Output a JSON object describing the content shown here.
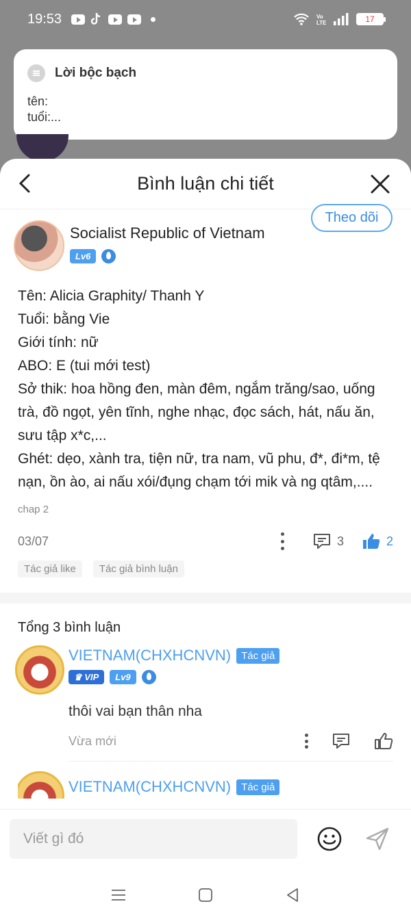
{
  "status_bar": {
    "time": "19:53",
    "battery": "17"
  },
  "notice": {
    "title": "Lời bộc bạch",
    "lines": [
      "tên:",
      "tuổi:..."
    ]
  },
  "sheet": {
    "title": "Bình luận chi tiết"
  },
  "post": {
    "author": "Socialist Republic of Vietnam",
    "level": "Lv6",
    "follow_label": "Theo dõi",
    "body": [
      "Tên: Alicia Graphity/ Thanh Y",
      "Tuổi: bằng Vie",
      "Giới tính: nữ",
      "ABO: E (tui mới test)",
      "Sở thik: hoa hồng đen, màn đêm, ngắm trăng/sao, uống trà, đồ ngọt, yên tĩnh, nghe nhạc, đọc sách, hát, nấu ăn, sưu tập x*c,...",
      "Ghét: dẹo, xành tra, tiện nữ, tra nam, vũ phu, đ*, đi*m, tệ nạn, ồn ào, ai nấu xói/đụng chạm tới mik và ng qtâm,...."
    ],
    "chapter": "chap 2",
    "date": "03/07",
    "comment_count": "3",
    "like_count": "2",
    "tags": [
      "Tác giả like",
      "Tác giả bình luận"
    ]
  },
  "comments": {
    "total_label": "Tổng 3 bình luận",
    "items": [
      {
        "name": "VIETNAM(CHXHCNVN)",
        "role": "Tác giả",
        "vip": "VIP",
        "level": "Lv9",
        "text": "thôi vai bạn thân nha",
        "time": "Vừa mới"
      },
      {
        "name": "VIETNAM(CHXHCNVN)",
        "role": "Tác giả"
      }
    ]
  },
  "composer": {
    "placeholder": "Viết gì đó"
  },
  "colors": {
    "accent": "#4d9ff0",
    "like": "#3a8de0"
  }
}
